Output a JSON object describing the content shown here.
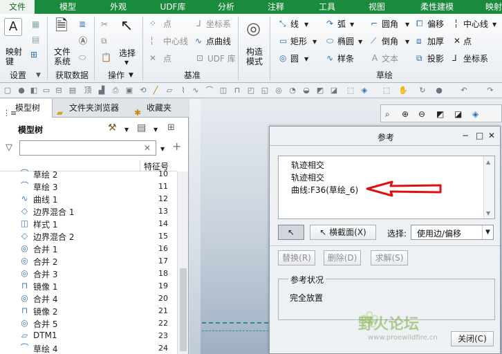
{
  "menubar": [
    "文件",
    "模型",
    "外观",
    "UDF库",
    "分析",
    "注释",
    "工具",
    "视图",
    "柔性建模",
    "映射"
  ],
  "ribbon": {
    "settings": {
      "icon_label": "A",
      "mapping_key": "映射\n键",
      "group": "设置"
    },
    "getdata": {
      "file_system": "文件\n系统",
      "group": "获取数据"
    },
    "operations": {
      "select": "选择",
      "group": "操作"
    },
    "datum": {
      "point1": "点",
      "coord1": "坐标系",
      "centerline": "中心线",
      "point_line": "点曲线",
      "point2": "点",
      "udf": "UDF 库",
      "group": "基准"
    },
    "construct": {
      "label": "构造\n模式"
    },
    "sketch": {
      "line": "线",
      "arc": "弧",
      "circle_corner": "圆角",
      "offset": "偏移",
      "centerline": "中心线",
      "rect": "矩形",
      "ellipse": "椭圆",
      "chamfer": "倒角",
      "thicken": "加厚",
      "point": "点",
      "circle": "圆",
      "spline": "样条",
      "text": "文本",
      "project": "投影",
      "coordsys": "坐标系",
      "group": "草绘"
    }
  },
  "left_panel": {
    "tabs": [
      "模型树",
      "文件夹浏览器",
      "收藏夹"
    ],
    "title": "模型树",
    "column_header": "特征号",
    "rows": [
      {
        "name": "草绘 2",
        "id": "10",
        "icon": "sketch"
      },
      {
        "name": "草绘 3",
        "id": "11",
        "icon": "sketch"
      },
      {
        "name": "曲线 1",
        "id": "12",
        "icon": "curve"
      },
      {
        "name": "边界混合 1",
        "id": "13",
        "icon": "blend"
      },
      {
        "name": "样式 1",
        "id": "14",
        "icon": "style"
      },
      {
        "name": "边界混合 2",
        "id": "15",
        "icon": "blend"
      },
      {
        "name": "合并 1",
        "id": "16",
        "icon": "merge"
      },
      {
        "name": "合并 2",
        "id": "17",
        "icon": "merge"
      },
      {
        "name": "合并 3",
        "id": "18",
        "icon": "merge"
      },
      {
        "name": "镜像 1",
        "id": "19",
        "icon": "mirror"
      },
      {
        "name": "合并 4",
        "id": "20",
        "icon": "merge"
      },
      {
        "name": "镜像 2",
        "id": "21",
        "icon": "mirror"
      },
      {
        "name": "合并 5",
        "id": "22",
        "icon": "merge"
      },
      {
        "name": "DTM1",
        "id": "23",
        "icon": "plane"
      },
      {
        "name": "草绘 4",
        "id": "24",
        "icon": "sketch"
      }
    ]
  },
  "dialog": {
    "title": "参考",
    "refs": [
      "轨迹相交",
      "轨迹相交",
      "曲线:F36(草绘_6)"
    ],
    "cross_section": "横截面(X)",
    "select_label": "选择:",
    "select_value": "使用边/偏移",
    "replace": "替换(R)",
    "delete": "删除(D)",
    "solve": "求解(S)",
    "status_title": "参考状况",
    "status_value": "完全放置",
    "close": "关闭(C)"
  },
  "watermark": {
    "text": "野火论坛",
    "url": "www.proewildfire.cn"
  },
  "colors": {
    "menubar": "#1a8a3c",
    "arrow": "#e01010",
    "accent": "#2a6fb8"
  }
}
